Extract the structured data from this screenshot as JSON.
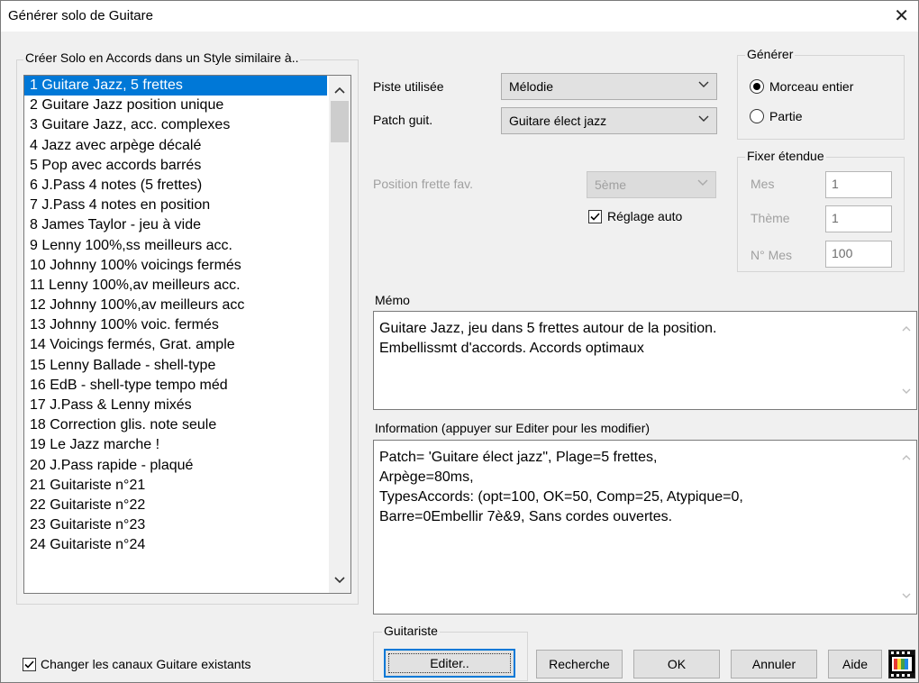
{
  "window": {
    "title": "Générer solo de Guitare",
    "close": "✕"
  },
  "style_group": {
    "label": "Créer Solo en Accords dans un Style similaire à..",
    "items": [
      "1 Guitare Jazz, 5 frettes",
      "2 Guitare Jazz position unique",
      "3 Guitare Jazz, acc. complexes",
      "4 Jazz avec arpège décalé",
      "5 Pop avec accords barrés",
      "6 J.Pass 4 notes (5 frettes)",
      "7 J.Pass 4 notes en position",
      "8 James Taylor - jeu à vide",
      "9 Lenny 100%,ss meilleurs acc.",
      "10 Johnny 100% voicings fermés",
      "11 Lenny 100%,av meilleurs acc.",
      "12 Johnny 100%,av meilleurs acc",
      "13 Johnny 100% voic. fermés",
      "14 Voicings fermés, Grat. ample",
      "15 Lenny Ballade - shell-type",
      "16 EdB - shell-type tempo méd",
      "17 J.Pass & Lenny mixés",
      "18 Correction glis. note seule",
      "19 Le Jazz marche !",
      "20 J.Pass rapide - plaqué",
      "21 Guitariste n°21",
      "22 Guitariste n°22",
      "23 Guitariste n°23",
      "24 Guitariste n°24"
    ],
    "selected_index": 0
  },
  "track": {
    "label": "Piste utilisée",
    "value": "Mélodie"
  },
  "patch": {
    "label": "Patch guit.",
    "value": "Guitare élect jazz"
  },
  "fret_position": {
    "label": "Position frette fav.",
    "value": "5ème"
  },
  "auto_setting": {
    "label": "Réglage auto",
    "checked": true
  },
  "generate": {
    "label": "Générer",
    "options": [
      "Morceau entier",
      "Partie"
    ],
    "selected": "Morceau entier"
  },
  "range": {
    "label": "Fixer étendue",
    "mes_label": "Mes",
    "mes_value": "1",
    "theme_label": "Thème",
    "theme_value": "1",
    "nmes_label": "N° Mes",
    "nmes_value": "100"
  },
  "memo": {
    "label": "Mémo",
    "lines": [
      "Guitare Jazz, jeu dans 5 frettes autour de la position.",
      "Embellissmt d'accords. Accords optimaux"
    ]
  },
  "info": {
    "label": "Information (appuyer sur Editer pour les modifier)",
    "lines": [
      "Patch= 'Guitare élect jazz\", Plage=5 frettes,",
      "Arpège=80ms,",
      "TypesAccords: (opt=100, OK=50, Comp=25, Atypique=0,",
      "Barre=0Embellir 7è&9, Sans cordes ouvertes."
    ]
  },
  "change_channels": {
    "label": "Changer les canaux Guitare existants",
    "checked": true
  },
  "guitarist": {
    "label": "Guitariste",
    "edit_button": "Editer.."
  },
  "buttons": {
    "search": "Recherche",
    "ok": "OK",
    "cancel": "Annuler",
    "help": "Aide"
  },
  "colors": {
    "selection": "#0078d7",
    "default_button_border": "#0078d7"
  }
}
